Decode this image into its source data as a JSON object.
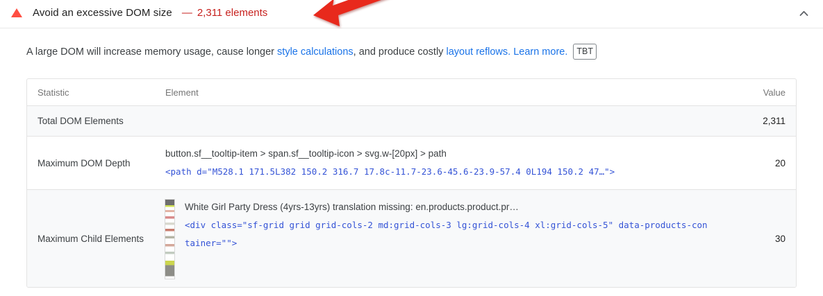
{
  "header": {
    "title": "Avoid an excessive DOM size",
    "separator": "—",
    "display_value": "2,311 elements"
  },
  "description": {
    "text_1": "A large DOM will increase memory usage, cause longer ",
    "link_style_calculations": "style calculations",
    "text_2": ", and produce costly ",
    "link_layout_reflows": "layout reflows.",
    "text_3": " ",
    "link_learn_more": "Learn more.",
    "metric_chip": "TBT"
  },
  "table": {
    "headers": {
      "statistic": "Statistic",
      "element": "Element",
      "value": "Value"
    },
    "rows": [
      {
        "statistic": "Total DOM Elements",
        "value": "2,311"
      },
      {
        "statistic": "Maximum DOM Depth",
        "selector": "button.sf__tooltip-item > span.sf__tooltip-icon > svg.w-[20px] > path",
        "snippet": "<path d=\"M528.1 171.5L382 150.2 316.7 17.8c-11.7-23.6-45.6-23.9-57.4 0L194 150.2 47…\">",
        "value": "20"
      },
      {
        "statistic": "Maximum Child Elements",
        "node_label": "White Girl Party Dress (4yrs-13yrs) translation missing: en.products.product.pr…",
        "snippet": "<div class=\"sf-grid grid grid-cols-2 md:grid-cols-3 lg:grid-cols-4 xl:grid-cols-5\" data-products-container=\"\">",
        "value": "30"
      }
    ]
  },
  "colors": {
    "fail_icon": "#ff4e42",
    "fail_text": "#c7221f",
    "link": "#1a73e8",
    "snippet_text": "#3453d6",
    "annotation_arrow": "#e8291c"
  }
}
